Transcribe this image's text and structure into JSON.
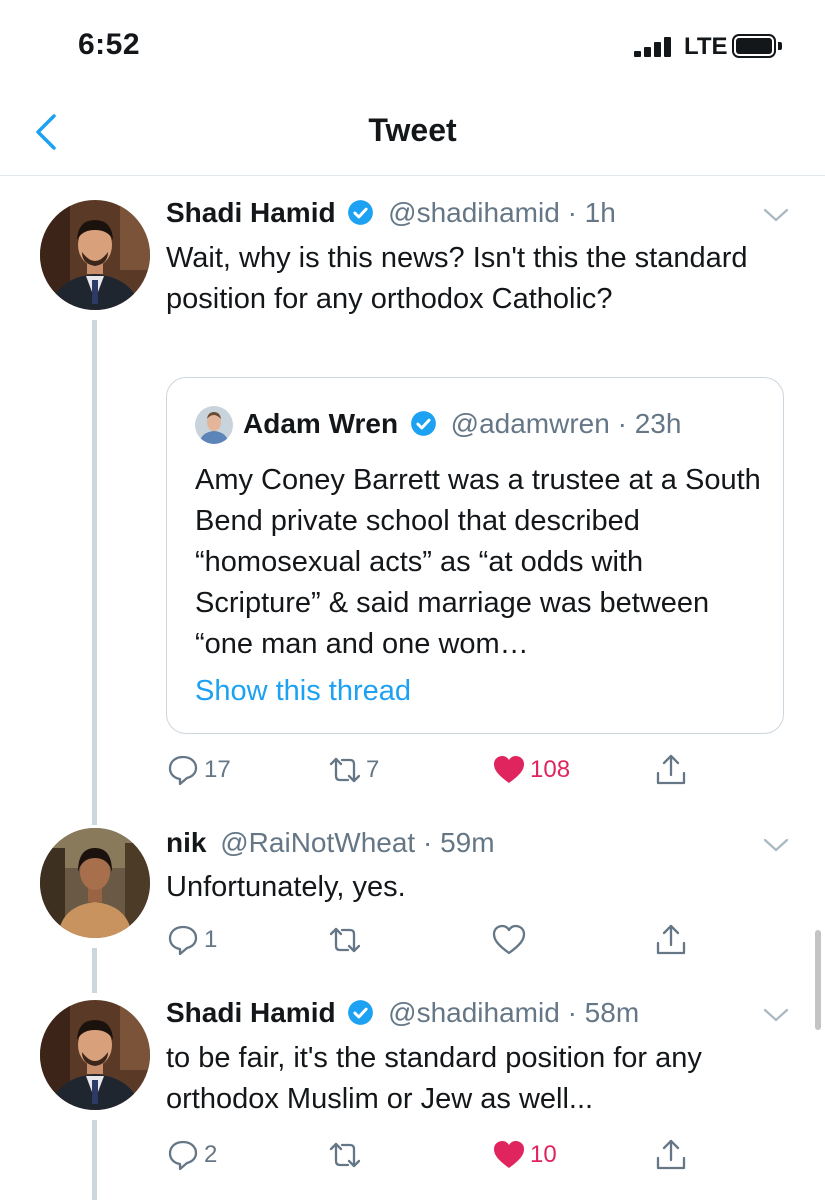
{
  "status_bar": {
    "time": "6:52",
    "network": "LTE"
  },
  "nav": {
    "title": "Tweet"
  },
  "tweets": [
    {
      "name": "Shadi Hamid",
      "handle": "@shadihamid",
      "sep": "·",
      "time": "1h",
      "text": "Wait, why is this news? Isn't this the standard position for any orthodox Catholic?",
      "actions": {
        "replies": "17",
        "retweets": "7",
        "likes": "108"
      },
      "quoted": {
        "name": "Adam Wren",
        "handle": "@adamwren",
        "sep": "·",
        "time": "23h",
        "text": "Amy Coney Barrett was a trustee at a South Bend private school that described “homosexual acts” as “at odds with Scripture” & said marriage was between “one man and one wom…",
        "link": "Show this thread"
      }
    },
    {
      "name": "nik",
      "handle": "@RaiNotWheat",
      "sep": "·",
      "time": "59m",
      "text": "Unfortunately, yes.",
      "actions": {
        "replies": "1",
        "retweets": "",
        "likes": ""
      }
    },
    {
      "name": "Shadi Hamid",
      "handle": "@shadihamid",
      "sep": "·",
      "time": "58m",
      "text": "to be fair, it's the standard position for any orthodox Muslim or Jew as well...",
      "actions": {
        "replies": "2",
        "retweets": "",
        "likes": "10"
      }
    }
  ],
  "colors": {
    "accent": "#1da1f2",
    "like": "#e0245e",
    "muted": "#657786",
    "border": "#ccd6dd"
  },
  "icons": [
    "back-chevron-icon",
    "verified-badge-icon",
    "chevron-down-icon",
    "reply-icon",
    "retweet-icon",
    "heart-icon",
    "share-icon"
  ]
}
